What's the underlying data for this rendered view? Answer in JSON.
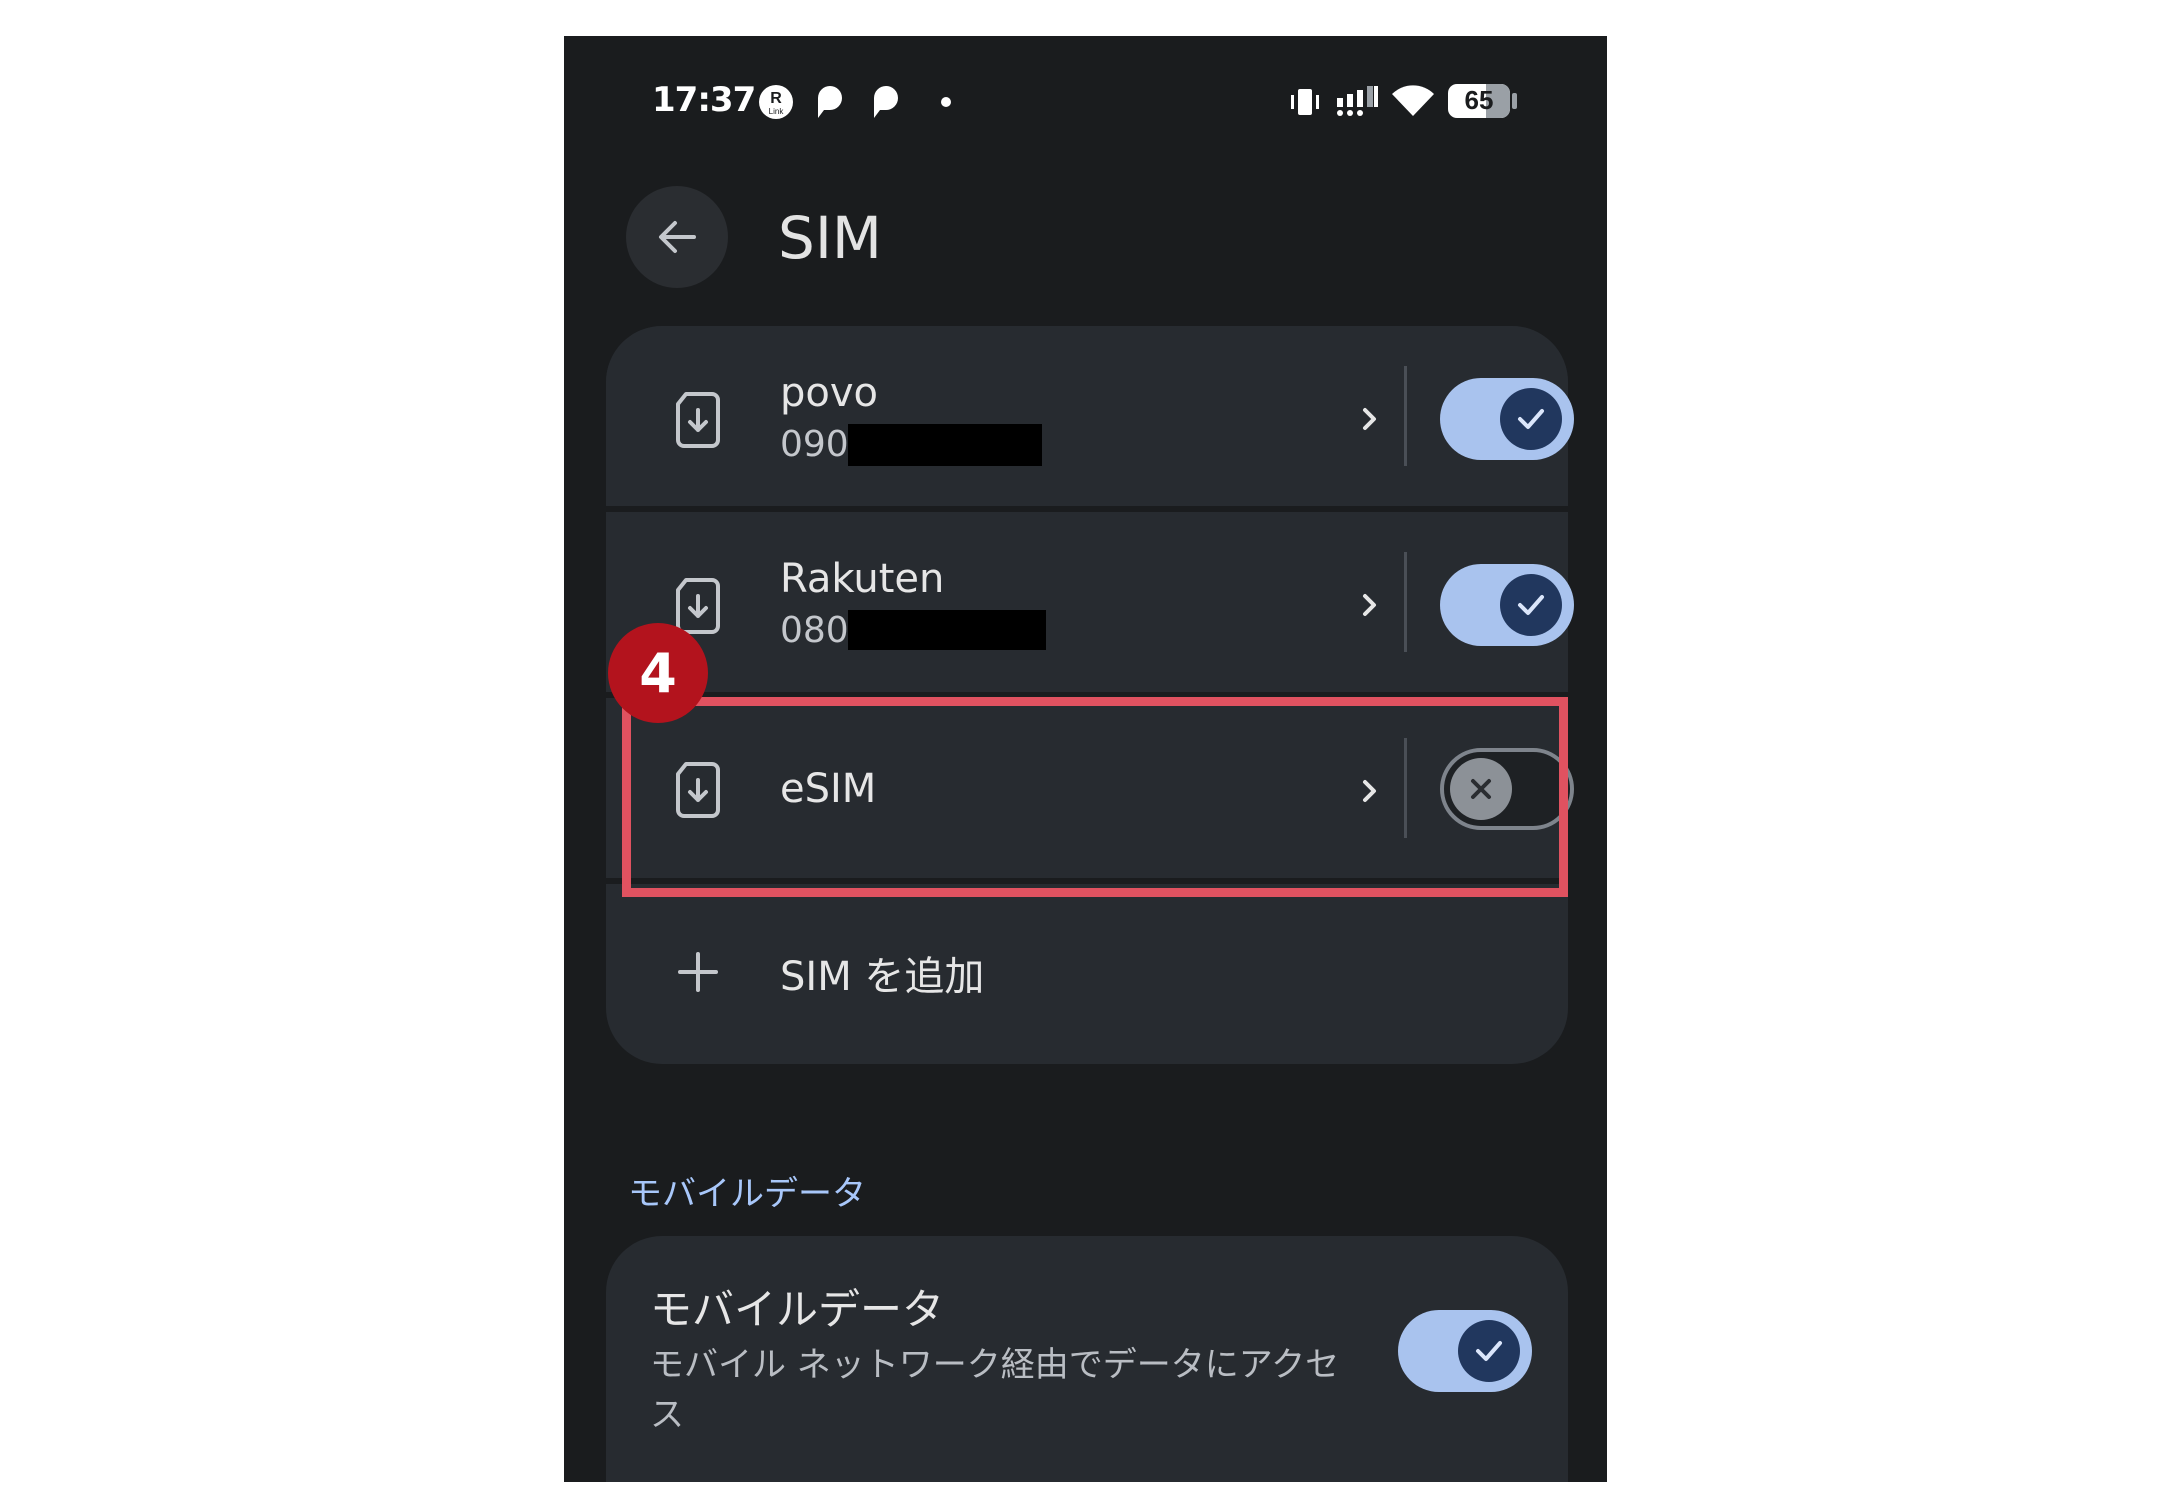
{
  "status_bar": {
    "time": "17:37",
    "battery_level": "65",
    "notification_icons": [
      "rakuten-link-icon",
      "povo-icon",
      "povo-icon",
      "dot-icon"
    ],
    "system_icons": [
      "vibrate-icon",
      "signal-icon",
      "wifi-icon",
      "battery-icon"
    ]
  },
  "header": {
    "title": "SIM",
    "back_icon": "arrow-left-icon"
  },
  "sims": [
    {
      "name": "povo",
      "number_prefix": "090",
      "enabled": true
    },
    {
      "name": "Rakuten",
      "number_prefix": "080",
      "enabled": true
    },
    {
      "name": "eSIM",
      "number_prefix": "",
      "enabled": false
    }
  ],
  "add_sim": {
    "label": "SIM を追加",
    "icon": "plus-icon"
  },
  "mobile_data_section": {
    "header": "モバイルデータ",
    "title": "モバイルデータ",
    "description": "モバイル ネットワーク経由でデータにアクセス",
    "enabled": true
  },
  "annotation": {
    "step_number": "4",
    "highlight_color": "#e05260",
    "badge_color": "#b3131d"
  },
  "colors": {
    "background": "#1a1c1e",
    "card": "#272b30",
    "toggle_on": "#a9c3ee",
    "accent_text": "#a8c7fa"
  }
}
